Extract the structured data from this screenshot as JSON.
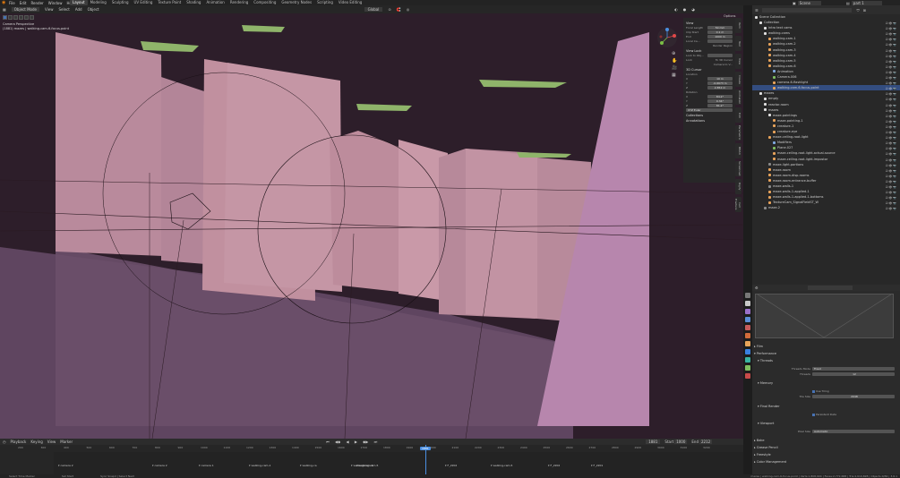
{
  "topbar": {
    "menu": [
      "File",
      "Edit",
      "Render",
      "Window",
      "Help"
    ],
    "workspaces": [
      "Layout",
      "Modeling",
      "Sculpting",
      "UV Editing",
      "Texture Paint",
      "Shading",
      "Animation",
      "Rendering",
      "Compositing",
      "Geometry Nodes",
      "Scripting",
      "Video Editing"
    ],
    "active_workspace": "Layout",
    "scene": "Scene",
    "view_layer": "part 1"
  },
  "viewport": {
    "mode": "Object Mode",
    "menus": [
      "View",
      "Select",
      "Add",
      "Object"
    ],
    "transform": "Global",
    "info_line1": "Camera Perspective",
    "info_line2": "(1881) mazes | walking-cam-6-focus-point",
    "options": "Options"
  },
  "npanel": {
    "view_title": "View",
    "focal_label": "Focal Length",
    "focal_value": "50 mm",
    "clip_start_label": "Clip Start",
    "clip_start_value": "0.1 m",
    "clip_end_label": "End",
    "clip_end_value": "1000 m",
    "local_camera_label": "Local Ca...",
    "render_region": "Render Region",
    "view_lock_title": "View Lock",
    "lock_to_obj_label": "Lock to Obj...",
    "lock_label": "Lock",
    "lock_3d_cursor": "To 3D Cursor",
    "lock_camera": "Camera to V...",
    "cursor_title": "3D Cursor",
    "location_label": "Location",
    "x_value": "10 m",
    "y_value": "-0.6673 m",
    "z_value": "2.852 m",
    "rotation_label": "Rotation",
    "rx_value": "84.2°",
    "ry_value": "0.34°",
    "rz_value": "81.2°",
    "rot_mode": "XYZ Euler",
    "collections_title": "Collections",
    "annotations_title": "Annotations",
    "tabs": [
      "Item",
      "Tool",
      "View",
      "Create",
      "Animation",
      "Edit",
      "Parametric",
      "BMAX",
      "Screencast",
      "Rigify",
      "Cell Fracture",
      "Relink",
      "Misc"
    ]
  },
  "timeline": {
    "menus": [
      "Playback",
      "Keying",
      "View",
      "Marker"
    ],
    "current_frame": "1881",
    "start_label": "Start",
    "start_value": "1000",
    "end_label": "End",
    "end_value": "2212",
    "ticks": [
      "200",
      "300",
      "400",
      "500",
      "600",
      "700",
      "800",
      "900",
      "1000",
      "1100",
      "1200",
      "1300",
      "1400",
      "1500",
      "1600",
      "1700",
      "1800",
      "1900",
      "2000",
      "2100",
      "2200",
      "2300",
      "2400",
      "2500",
      "2600",
      "2700",
      "2800",
      "2900",
      "3000",
      "3100",
      "3200"
    ],
    "markers": [
      "camera 2",
      "camera 2",
      "camera 1",
      "walking-cam-1",
      "walking-ca",
      "walking-cam-4",
      "walking-cam-5",
      "walking-cam-5",
      "F_2202",
      "F_2202",
      "F_2201"
    ]
  },
  "statusbar": {
    "left1": "Select Time Marker",
    "left2": "Set Start",
    "left3": "Sync Snapd | Select Next",
    "right": "mazes | walking-cam-6-focus-point | Verts:1,808,904 | Faces:2,772,688 | Tris:4,919,828 | Objects:0/84 | 3.6.1"
  },
  "outliner": {
    "title": "Scene Collection",
    "rows": [
      {
        "label": "Collection",
        "depth": 1,
        "color": "#e0e0e0"
      },
      {
        "label": "intro text cams",
        "depth": 2,
        "color": "#e0e0e0"
      },
      {
        "label": "walking-cams",
        "depth": 2,
        "color": "#e0e0e0"
      },
      {
        "label": "walking-cam-1",
        "depth": 3,
        "color": "#e8a35a"
      },
      {
        "label": "walking-cam-2",
        "depth": 3,
        "color": "#e8a35a"
      },
      {
        "label": "walking-cam-3",
        "depth": 3,
        "color": "#e8a35a"
      },
      {
        "label": "walking-cam-4",
        "depth": 3,
        "color": "#e8a35a"
      },
      {
        "label": "walking-cam-5",
        "depth": 3,
        "color": "#e8a35a"
      },
      {
        "label": "walking-cam-6",
        "depth": 3,
        "color": "#e8a35a"
      },
      {
        "label": "Animation",
        "depth": 4,
        "color": "#80a8e0"
      },
      {
        "label": "Camera.006",
        "depth": 4,
        "color": "#7fbf5f"
      },
      {
        "label": "camera-6-flashlight",
        "depth": 4,
        "color": "#e8a35a"
      },
      {
        "label": "walking-cam-6-focus-point",
        "depth": 4,
        "color": "#e8a35a"
      },
      {
        "label": "mazes",
        "depth": 1,
        "color": "#e0e0e0"
      },
      {
        "label": "empty",
        "depth": 2,
        "color": "#e0e0e0"
      },
      {
        "label": "reactor-room",
        "depth": 2,
        "color": "#e0e0e0"
      },
      {
        "label": "mazes",
        "depth": 2,
        "color": "#e0e0e0"
      },
      {
        "label": "maze-paintings",
        "depth": 3,
        "color": "#e0e0e0"
      },
      {
        "label": "maze-painting-1",
        "depth": 4,
        "color": "#e8a35a"
      },
      {
        "label": "creature-1",
        "depth": 4,
        "color": "#e8a35a"
      },
      {
        "label": "creature-eye",
        "depth": 4,
        "color": "#e8a35a"
      },
      {
        "label": "maze-ceiling-root-light",
        "depth": 3,
        "color": "#e8a35a"
      },
      {
        "label": "Modifiers",
        "depth": 4,
        "color": "#80a8e0"
      },
      {
        "label": "Plane.027",
        "depth": 4,
        "color": "#7fbf5f"
      },
      {
        "label": "maze-ceiling-root-light-actual-source",
        "depth": 4,
        "color": "#e8a35a"
      },
      {
        "label": "maze-ceiling-root-light-impostor",
        "depth": 4,
        "color": "#e8a35a"
      },
      {
        "label": "maze-light-portions",
        "depth": 3,
        "color": "#8a8a8a"
      },
      {
        "label": "maze-room",
        "depth": 3,
        "color": "#e8a35a"
      },
      {
        "label": "maze-room-disp-rooms",
        "depth": 3,
        "color": "#e8a35a"
      },
      {
        "label": "maze-room-entrance-buffer",
        "depth": 3,
        "color": "#e8a35a"
      },
      {
        "label": "maze-walls-1",
        "depth": 3,
        "color": "#8a8a8a"
      },
      {
        "label": "maze-walls-1-applied-1",
        "depth": 3,
        "color": "#e8a35a"
      },
      {
        "label": "maze-walls-1-applied-1-bottoms",
        "depth": 3,
        "color": "#e8a35a"
      },
      {
        "label": "TextureCam_SignalFieldST_W",
        "depth": 3,
        "color": "#e8a35a"
      },
      {
        "label": "maze-2",
        "depth": 2,
        "color": "#8a8a8a"
      }
    ]
  },
  "props": {
    "sections": {
      "film": "Film",
      "performance": "Performance",
      "threads": "Threads",
      "threads_mode_label": "Threads Mode",
      "threads_mode_value": "Fixed",
      "threads_label": "Threads",
      "threads_value": "12",
      "memory": "Memory",
      "use_tiling": "Use Tiling",
      "tile_size_label": "Tile Size",
      "tile_size_value": "2048",
      "final_render": "Final Render",
      "persistent_data": "Persistent Data",
      "viewport": "Viewport",
      "pixel_size_label": "Pixel Size",
      "pixel_size_value": "Automatic",
      "bake": "Bake",
      "grease_pencil": "Grease Pencil",
      "freestyle": "Freestyle",
      "color_management": "Color Management"
    }
  }
}
